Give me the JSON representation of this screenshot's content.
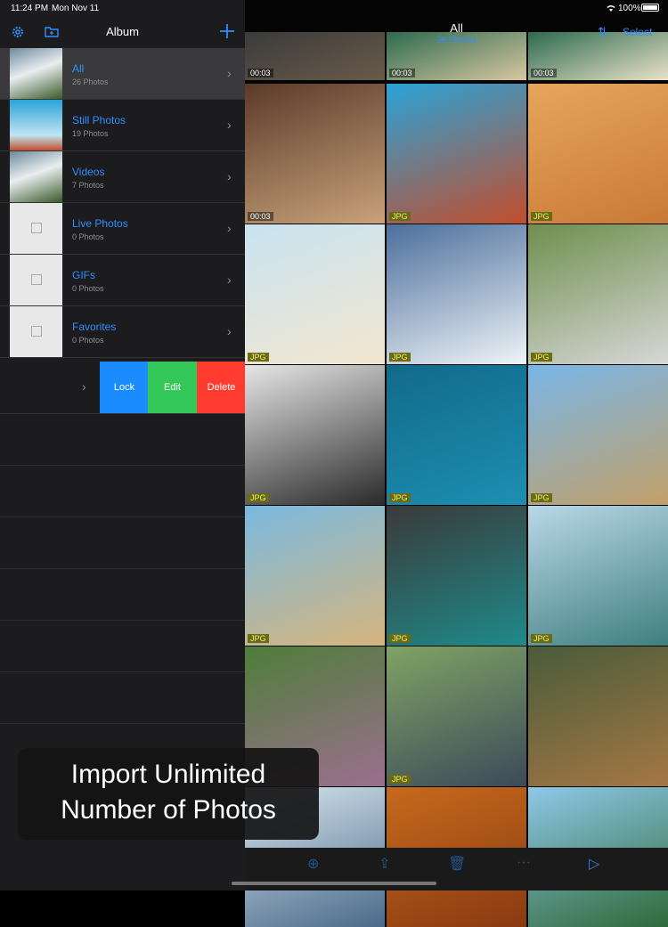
{
  "status": {
    "time": "11:24 PM",
    "date": "Mon Nov 11",
    "battery": "100%",
    "battery_level": 1.0
  },
  "sidebar": {
    "title": "Album",
    "icons": [
      "gear-icon",
      "folder-icon",
      "plus-icon"
    ],
    "albums": [
      {
        "name": "All",
        "count": "26 Photos"
      },
      {
        "name": "Still Photos",
        "count": "19 Photos"
      },
      {
        "name": "Videos",
        "count": "7 Photos"
      },
      {
        "name": "Live Photos",
        "count": "0 Photos"
      },
      {
        "name": "GIFs",
        "count": "0 Photos"
      },
      {
        "name": "Favorites",
        "count": "0 Photos"
      }
    ],
    "swipe_actions": [
      {
        "label": "Lock",
        "color": "#1a8cff"
      },
      {
        "label": "Edit",
        "color": "#34c759"
      },
      {
        "label": "Delete",
        "color": "#ff3b30"
      }
    ]
  },
  "main": {
    "title": "All",
    "subtitle": "26 Photos",
    "select_label": "Select",
    "sort_icon": "sort-arrows-icon",
    "tiles": [
      {
        "badge": "00:03",
        "colors": [
          "#3b3b3b",
          "#6a5a4a"
        ]
      },
      {
        "badge": "00:03",
        "colors": [
          "#2d6a4f",
          "#d8c7a0"
        ]
      },
      {
        "badge": "00:03",
        "colors": [
          "#2d6a4f",
          "#e9e2c8"
        ]
      },
      {
        "badge": "00:03",
        "colors": [
          "#5b3a2a",
          "#c9a27a"
        ]
      },
      {
        "badge": "JPG",
        "colors": [
          "#2aa3d8",
          "#c24d2c"
        ]
      },
      {
        "badge": "JPG",
        "colors": [
          "#e7a55a",
          "#c97a36"
        ]
      },
      {
        "badge": "JPG",
        "colors": [
          "#c9e3f1",
          "#f2e6cf"
        ]
      },
      {
        "badge": "JPG",
        "colors": [
          "#4c6f9c",
          "#eef3f7"
        ]
      },
      {
        "badge": "JPG",
        "colors": [
          "#6f8f4d",
          "#d7d7d7"
        ]
      },
      {
        "badge": "JPG",
        "colors": [
          "#e6e6e6",
          "#2a2a2a"
        ]
      },
      {
        "badge": "JPG",
        "colors": [
          "#136a8a",
          "#1c8fb2"
        ]
      },
      {
        "badge": "JPG",
        "colors": [
          "#79b6e8",
          "#c2a06a"
        ]
      },
      {
        "badge": "JPG",
        "colors": [
          "#7ab9e0",
          "#d6b57d"
        ]
      },
      {
        "badge": "JPG",
        "colors": [
          "#3a3a3a",
          "#1f8a8a"
        ]
      },
      {
        "badge": "JPG",
        "colors": [
          "#b9d8e8",
          "#3f7f7f"
        ]
      },
      {
        "badge": "",
        "colors": [
          "#4f7d3a",
          "#9c6f8f"
        ]
      },
      {
        "badge": "JPG",
        "colors": [
          "#7fa364",
          "#3c4a5a"
        ]
      },
      {
        "badge": "",
        "colors": [
          "#495c3a",
          "#a57744"
        ]
      },
      {
        "badge": "",
        "colors": [
          "#d8e6ef",
          "#4a6a8a"
        ]
      },
      {
        "badge": "",
        "colors": [
          "#c56a1c",
          "#8a3a12"
        ]
      },
      {
        "badge": "",
        "colors": [
          "#8fc8e8",
          "#2f6a3a"
        ]
      }
    ]
  },
  "toolbar": {
    "icons": [
      "add-icon",
      "share-icon",
      "trash-icon",
      "more-icon",
      "play-icon"
    ]
  },
  "overlay": {
    "line1": "Import Unlimited",
    "line2": "Number of Photos"
  }
}
